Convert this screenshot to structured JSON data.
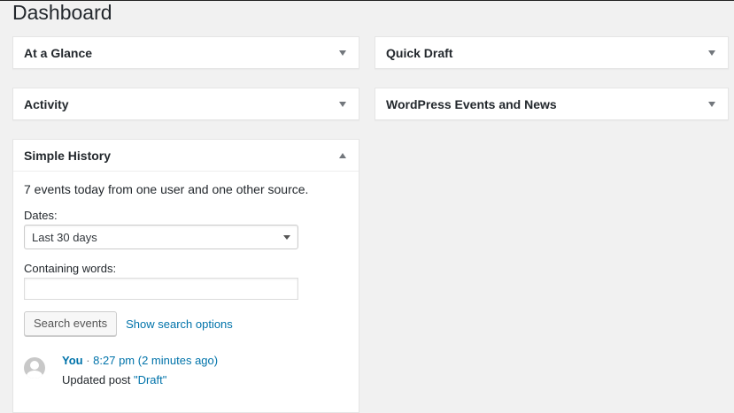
{
  "page": {
    "title": "Dashboard"
  },
  "widgets": {
    "at_a_glance": {
      "title": "At a Glance",
      "toggle_icon": "triangle-down"
    },
    "quick_draft": {
      "title": "Quick Draft",
      "toggle_icon": "triangle-down"
    },
    "activity": {
      "title": "Activity",
      "toggle_icon": "triangle-down"
    },
    "events_news": {
      "title": "WordPress Events and News",
      "toggle_icon": "triangle-down"
    },
    "simple_history": {
      "title": "Simple History",
      "toggle_icon": "triangle-up",
      "summary": "7 events today from one user and one other source.",
      "dates_label": "Dates:",
      "dates_selected": "Last 30 days",
      "words_label": "Containing words:",
      "words_value": "",
      "search_button": "Search events",
      "show_options_link": "Show search options",
      "events": [
        {
          "user": "You",
          "separator": " · ",
          "time": "8:27 pm",
          "relative": "(2 minutes ago)",
          "action": "Updated post ",
          "target": "\"Draft\""
        }
      ]
    }
  },
  "colors": {
    "background": "#f1f1f1",
    "link": "#0073aa",
    "text": "#23282d"
  }
}
